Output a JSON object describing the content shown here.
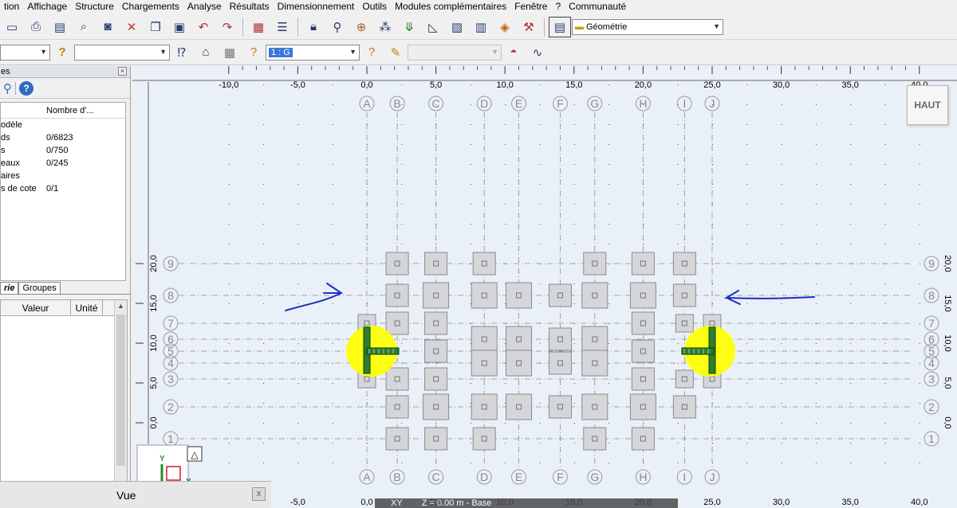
{
  "menu": [
    "tion",
    "Affichage",
    "Structure",
    "Chargements",
    "Analyse",
    "Résultats",
    "Dimensionnement",
    "Outils",
    "Modules complémentaires",
    "Fenêtre",
    "?",
    "Communauté"
  ],
  "toolbar1": {
    "icons": [
      "new-file-icon",
      "print-icon",
      "library-icon",
      "preview-icon",
      "screenshot-icon",
      "delete-icon",
      "copy-icon",
      "paste-icon",
      "undo-icon",
      "redo-icon",
      "calculator-icon",
      "table-icon",
      "lock-icon",
      "zoom-icon",
      "target-icon",
      "nodes-icon",
      "load-icon",
      "dimension-icon",
      "bars-icon",
      "section-icon",
      "cube-icon",
      "tools-icon"
    ],
    "layout_select": "Géométrie"
  },
  "toolbar2": {
    "case_value": "1 : G"
  },
  "left_panel": {
    "header": "es",
    "tree_header": "Nombre d'...",
    "rows": [
      {
        "label": "odèle",
        "value": ""
      },
      {
        "label": "ds",
        "value": "0/6823"
      },
      {
        "label": "s",
        "value": "0/750"
      },
      {
        "label": "eaux",
        "value": "0/245"
      },
      {
        "label": "aires",
        "value": ""
      },
      {
        "label": "s de cote",
        "value": "0/1"
      }
    ],
    "tabs": [
      "rie",
      "Groupes"
    ],
    "prop_headers": {
      "value": "Valeur",
      "unit": "Unité"
    }
  },
  "vue_panel": {
    "title": "Vue",
    "close": "x"
  },
  "canvas": {
    "view_cube": "HAUT",
    "x_ticks": [
      "-10,0",
      "-5,0",
      "0,0",
      "5,0",
      "10,0",
      "15,0",
      "20,0",
      "25,0",
      "30,0",
      "35,0",
      "40,0"
    ],
    "x_ticks_bottom": [
      "-5,0",
      "0,0",
      "5,0",
      "10,0",
      "15,0",
      "20,0",
      "25,0",
      "30,0",
      "35,0",
      "40,0"
    ],
    "y_ticks": [
      "20,0",
      "15,0",
      "10,0",
      "5,0",
      "0,0"
    ],
    "grid_columns": [
      "A",
      "B",
      "C",
      "D",
      "E",
      "F",
      "G",
      "H",
      "I",
      "J"
    ],
    "grid_rows": [
      "9",
      "8",
      "7",
      "6",
      "5",
      "4",
      "3",
      "2",
      "1"
    ],
    "status_plane": "XY",
    "status_z": "Z = 0.00 m - Base",
    "colors": {
      "background": "#eaf0f8",
      "highlight": "#ffff00",
      "member": "#2e7d32",
      "annotation": "#1b2fbf",
      "footing": "#d4d6da"
    }
  }
}
